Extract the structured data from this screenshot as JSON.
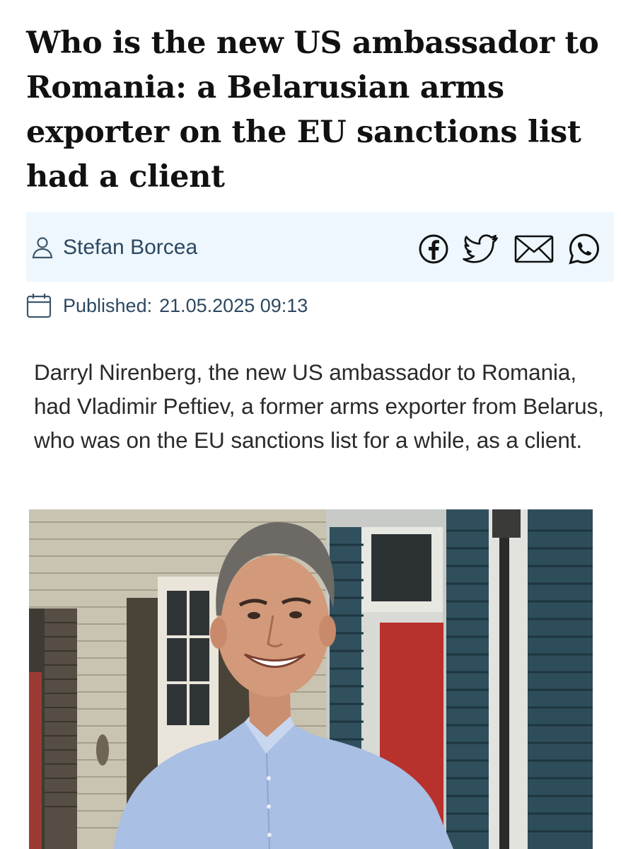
{
  "article": {
    "headline": "Who is the new US ambassador to Romania: a Belarusian arms exporter on the EU sanctions list had a client",
    "author": {
      "name": "Stefan Borcea",
      "icon": "user-icon"
    },
    "share": [
      {
        "name": "facebook",
        "icon": "facebook-icon"
      },
      {
        "name": "twitter",
        "icon": "twitter-icon"
      },
      {
        "name": "email",
        "icon": "envelope-icon"
      },
      {
        "name": "whatsapp",
        "icon": "whatsapp-icon"
      }
    ],
    "published_label": "Published:",
    "published_date": "21.05.2025 09:13",
    "lead": "Darryl Nirenberg, the new US ambassador to Romania, had Vladimir Peftiev, a former arms exporter from Belarus, who was on the EU sanctions list for a while, as a client."
  },
  "colors": {
    "meta_text": "#2d4860",
    "author_bar_bg": "#eef7fd",
    "headline": "#111111",
    "body_text": "#2a2a2a"
  }
}
